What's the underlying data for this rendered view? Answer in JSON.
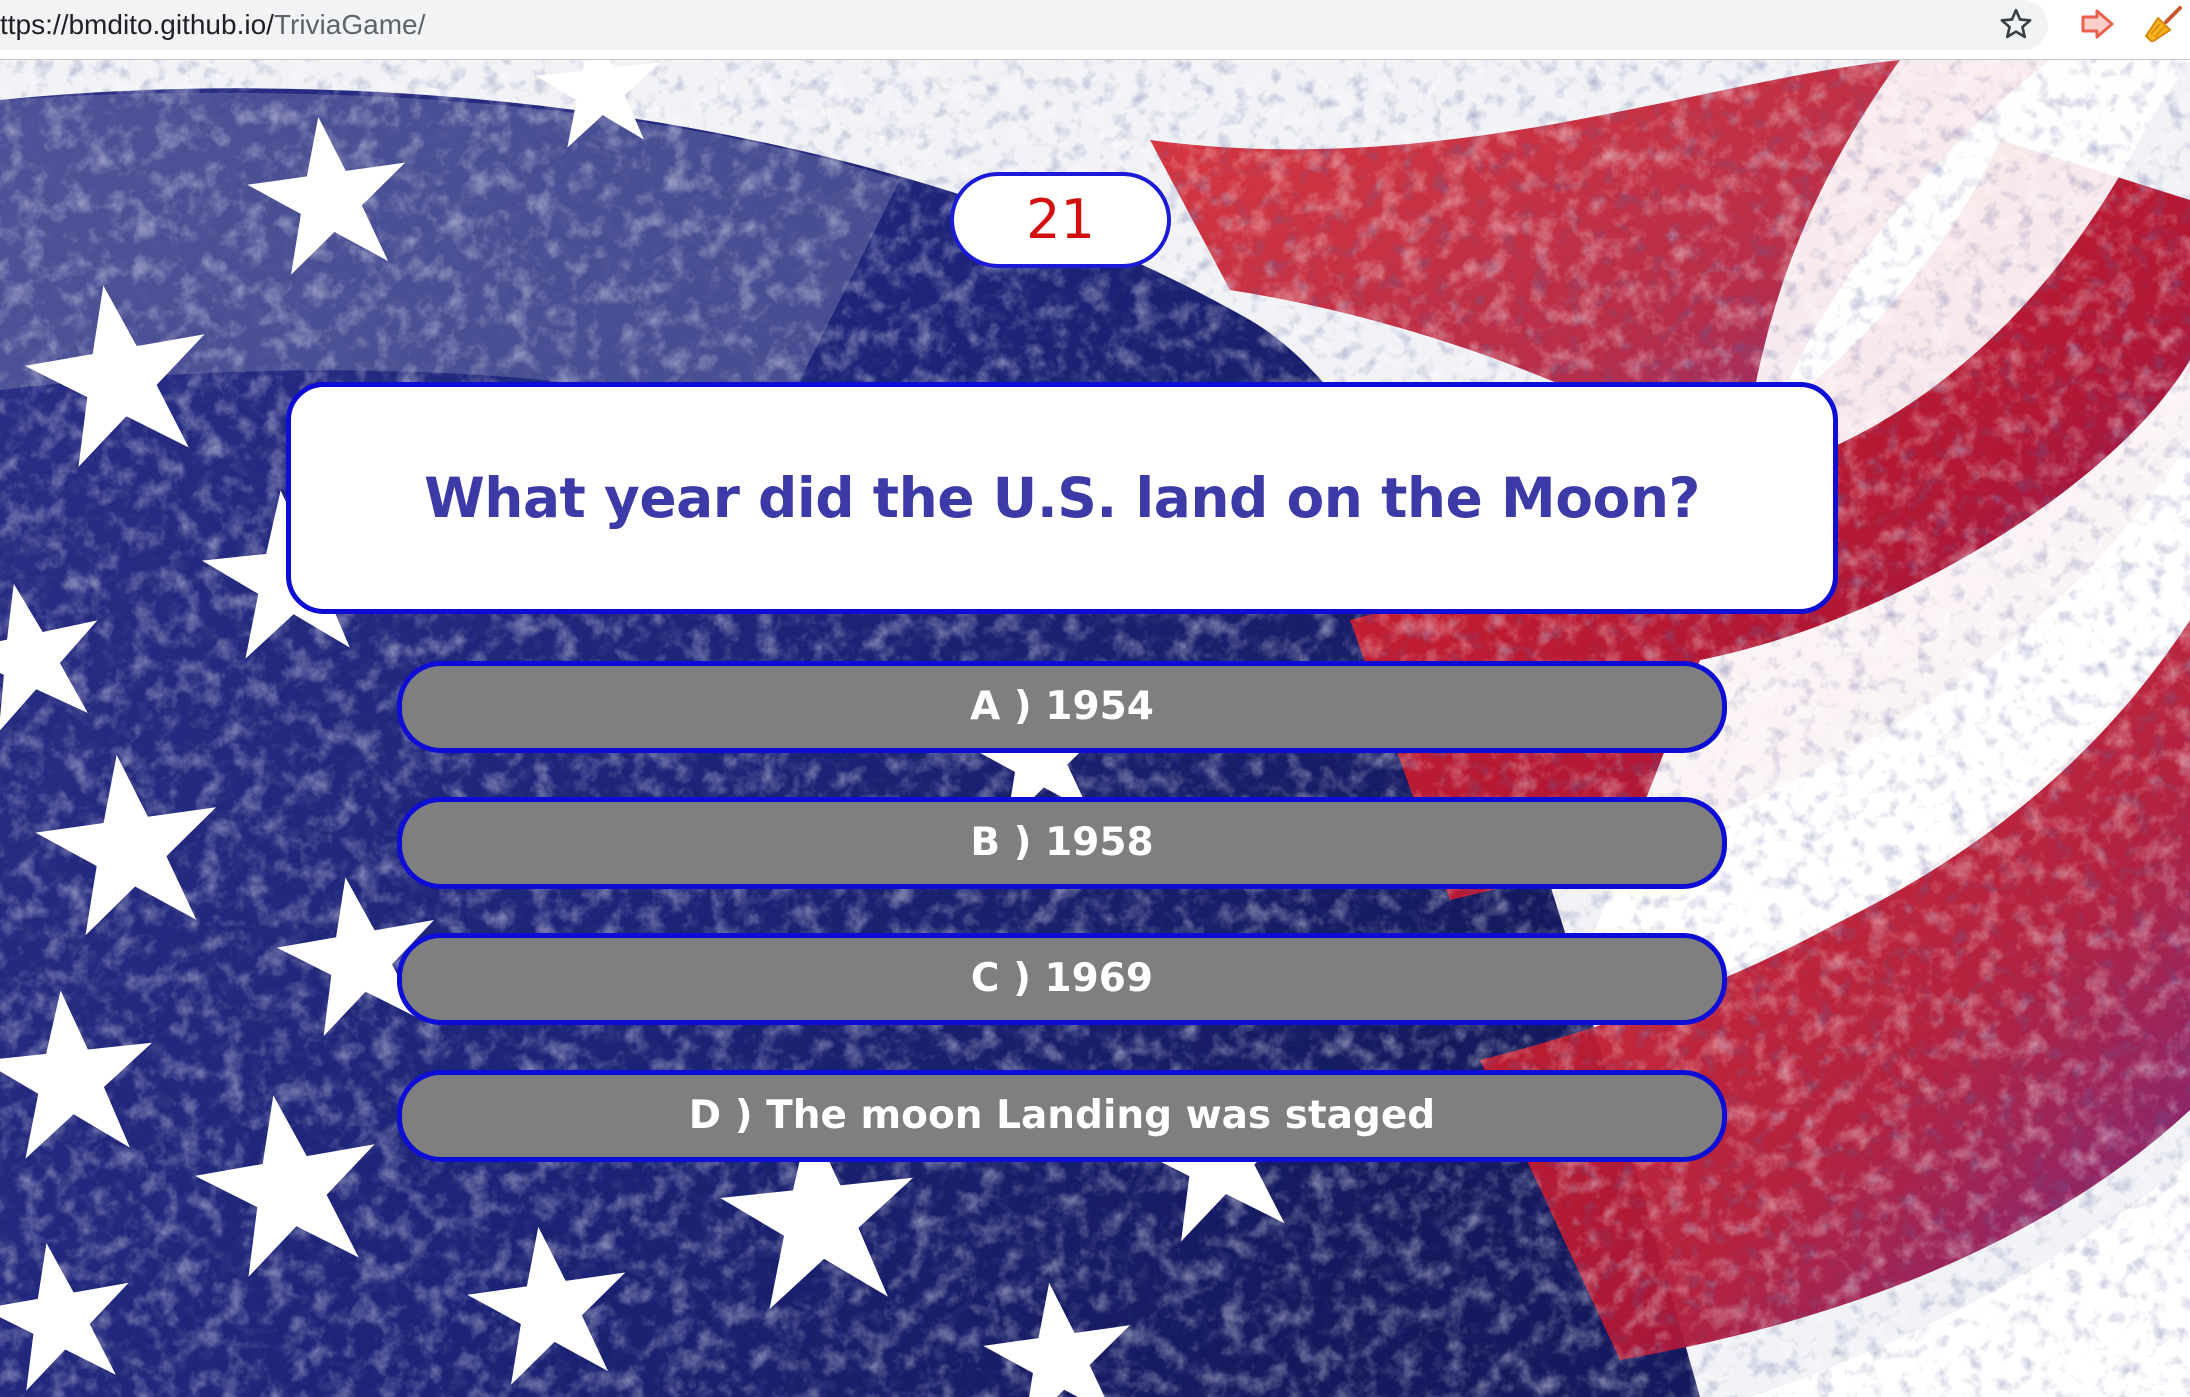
{
  "browser": {
    "url_host": "ttps://bmdito.github.io/",
    "url_path": "TriviaGame/",
    "icons": [
      "star-icon",
      "extension-arrow-icon",
      "extension-broom-icon"
    ]
  },
  "game": {
    "timer": "21",
    "question": "What year did the U.S. land on the Moon?",
    "answers": [
      {
        "letter": "A",
        "label": "A ) 1954"
      },
      {
        "letter": "B",
        "label": "B ) 1958"
      },
      {
        "letter": "C",
        "label": "C ) 1969"
      },
      {
        "letter": "D",
        "label": "D ) The moon Landing was staged"
      }
    ]
  },
  "colors": {
    "accent_border": "#0d0dd6",
    "question_text": "#3b3aa6",
    "timer_text": "#d40f0f",
    "answer_fill": "#7f7f7f",
    "answer_text": "#ffffff"
  }
}
